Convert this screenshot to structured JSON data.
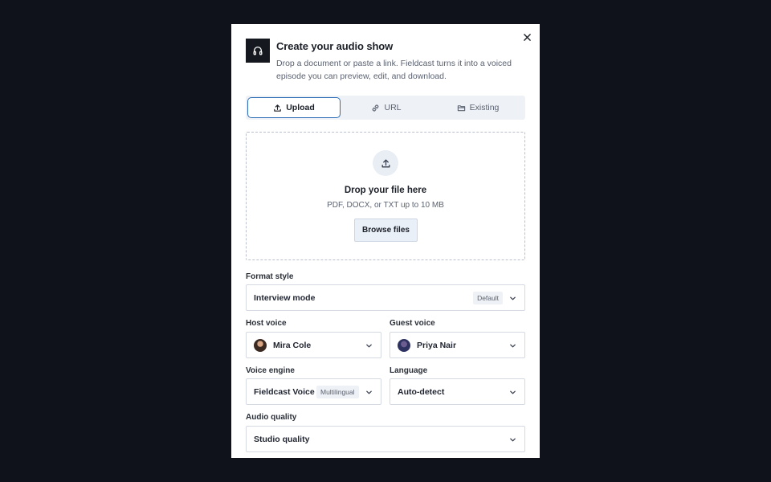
{
  "modal": {
    "title": "Create your audio show",
    "subtitle": "Drop a document or paste a link. Fieldcast turns it into a voiced episode you can preview, edit, and download."
  },
  "tabs": [
    {
      "label": "Upload",
      "icon": "upload-icon",
      "active": true
    },
    {
      "label": "URL",
      "icon": "link-icon",
      "active": false
    },
    {
      "label": "Existing",
      "icon": "folder-icon",
      "active": false
    }
  ],
  "dropzone": {
    "title": "Drop your file here",
    "subtitle": "PDF, DOCX, or TXT up to 10 MB",
    "button": "Browse files"
  },
  "format_style": {
    "label": "Format style",
    "value": "Interview mode",
    "badge": "Default"
  },
  "host_voice": {
    "label": "Host voice",
    "value": "Mira Cole"
  },
  "guest_voice": {
    "label": "Guest voice",
    "value": "Priya Nair"
  },
  "voice_engine": {
    "label": "Voice engine",
    "value": "Fieldcast Voice",
    "badge": "Multilingual"
  },
  "language": {
    "label": "Language",
    "value": "Auto-detect"
  },
  "audio_quality": {
    "label": "Audio quality",
    "value": "Studio quality"
  },
  "colors": {
    "accent": "#2c6db5",
    "backdrop": "#0f121a",
    "icon_tile": "#15191f"
  }
}
